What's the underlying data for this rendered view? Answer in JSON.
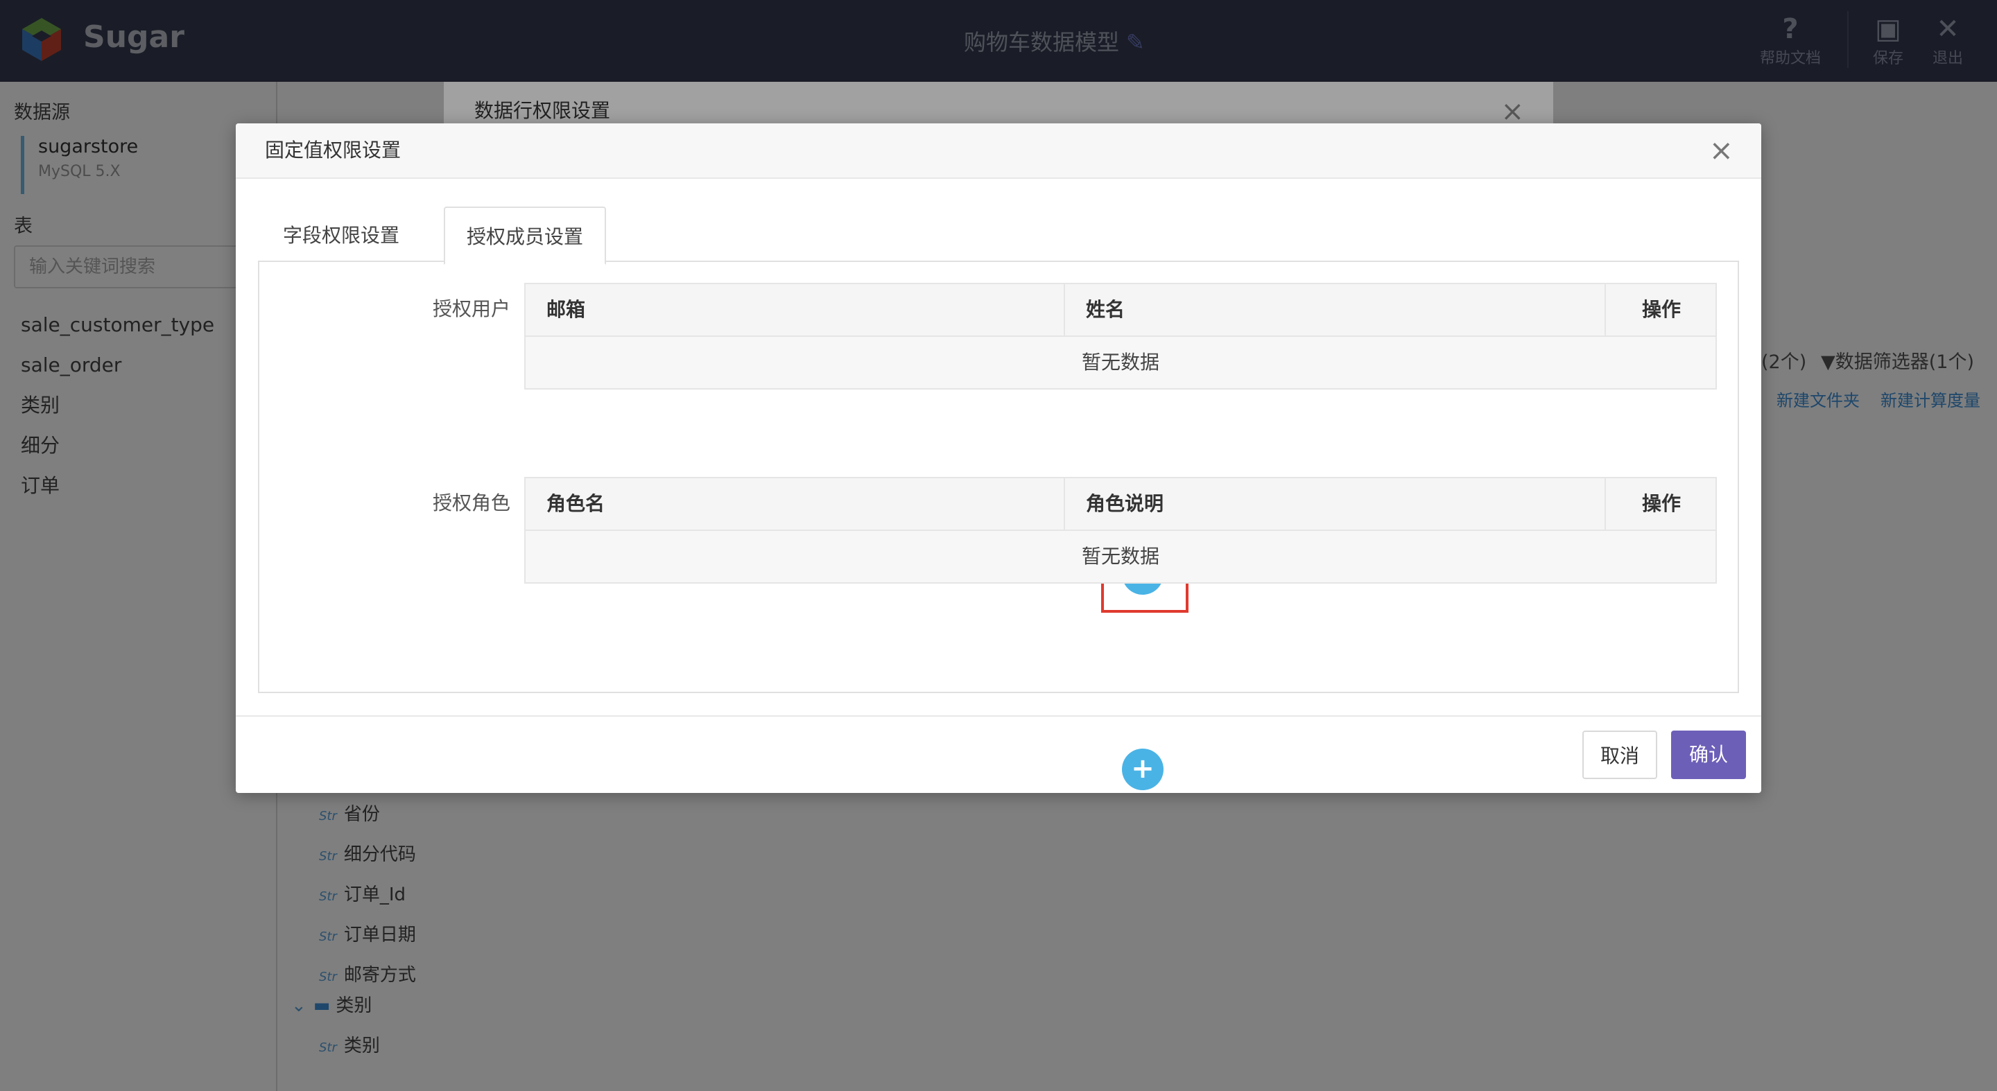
{
  "topbar": {
    "brand": "Sugar",
    "title": "购物车数据模型",
    "help_label": "帮助文档",
    "save_label": "保存",
    "exit_label": "退出"
  },
  "sidebar": {
    "datasource_label": "数据源",
    "datasource_name": "sugarstore",
    "datasource_version": "MySQL 5.X",
    "table_label": "表",
    "search_placeholder": "输入关键词搜索",
    "tables": [
      "sale_customer_type",
      "sale_order",
      "类别",
      "细分",
      "订单"
    ]
  },
  "main": {
    "counts_text": "(2个)",
    "filter_text": "数据筛选器(1个)",
    "new_folder": "新建文件夹",
    "new_measure": "新建计算度量",
    "field_type": "Str",
    "fields": [
      "省份",
      "细分代码",
      "订单_Id",
      "订单日期",
      "邮寄方式"
    ],
    "folder_name": "类别",
    "folder_field": "类别"
  },
  "back_modal": {
    "title": "数据行权限设置"
  },
  "modal": {
    "title": "固定值权限设置",
    "tabs": [
      "字段权限设置",
      "授权成员设置"
    ],
    "users_label": "授权用户",
    "users_columns": [
      "邮箱",
      "姓名",
      "操作"
    ],
    "users_empty": "暂无数据",
    "roles_label": "授权角色",
    "roles_columns": [
      "角色名",
      "角色说明",
      "操作"
    ],
    "roles_empty": "暂无数据",
    "cancel_label": "取消",
    "ok_label": "确认"
  },
  "colors": {
    "topbar_bg": "#343a4f",
    "accent": "#6c5fb8",
    "add_button": "#4ab3e6",
    "highlight": "#e03a2f"
  }
}
